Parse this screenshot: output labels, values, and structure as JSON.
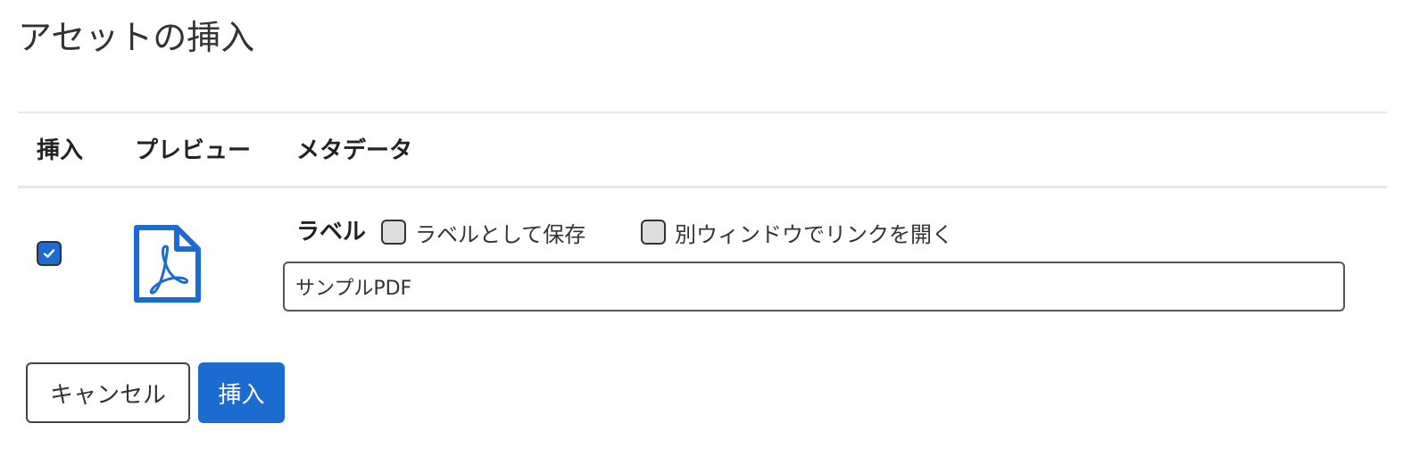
{
  "dialog": {
    "title": "アセットの挿入"
  },
  "table": {
    "columns": [
      "挿入",
      "プレビュー",
      "メタデータ"
    ],
    "row": {
      "insert_checked": true,
      "preview_icon": "pdf-file-icon",
      "metadata": {
        "label_title": "ラベル",
        "save_as_label": {
          "text": "ラベルとして保存",
          "checked": false
        },
        "open_in_new_window": {
          "text": "別ウィンドウでリンクを開く",
          "checked": false
        },
        "label_value": "サンプルPDF"
      }
    }
  },
  "buttons": {
    "cancel": "キャンセル",
    "insert": "挿入"
  },
  "colors": {
    "accent": "#1b6bd0",
    "divider": "#e6e6e6",
    "checkbox_unchecked": "#dddddd"
  }
}
